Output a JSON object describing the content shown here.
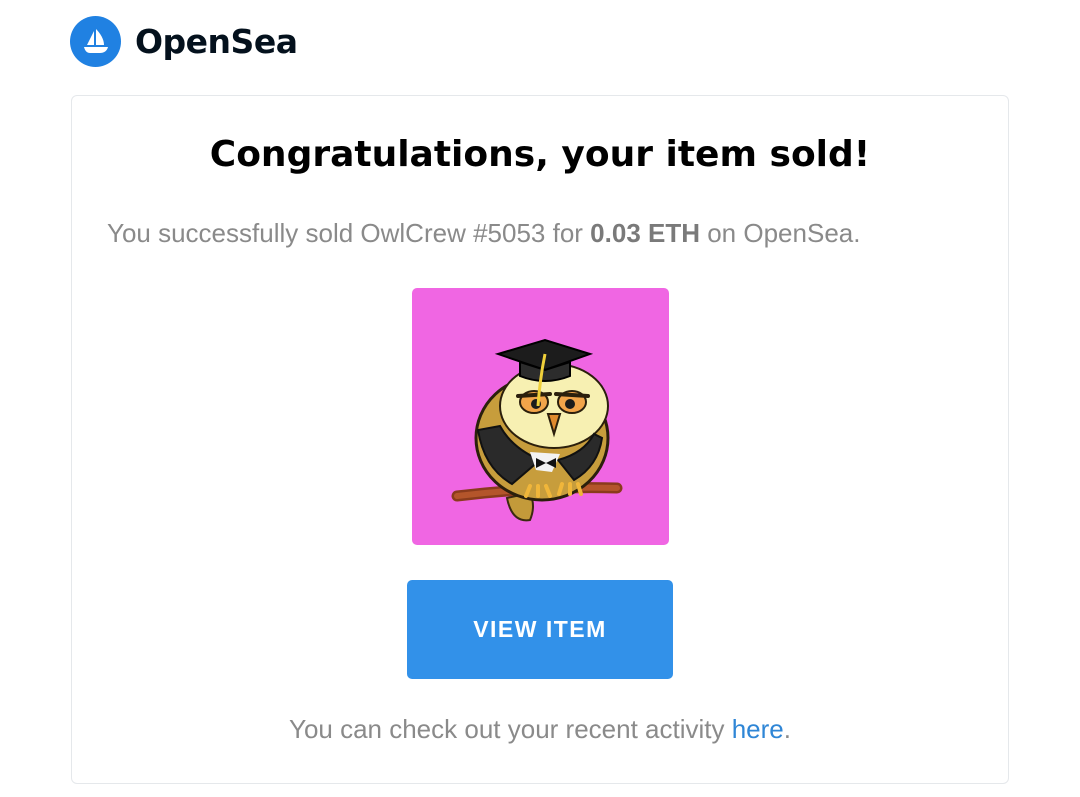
{
  "header": {
    "brand_name": "OpenSea",
    "logo_icon": "opensea-ship-icon",
    "brand_color": "#2081e2"
  },
  "main": {
    "headline": "Congratulations, your item sold!",
    "message": {
      "prefix": "You successfully sold OwlCrew #5053 for ",
      "price": "0.03 ETH",
      "suffix": " on OpenSea."
    },
    "item_image": {
      "icon": "owl-graduate-nft-image",
      "background": "#f066e3"
    },
    "view_button_label": "VIEW ITEM",
    "button_color": "#3291e9",
    "footer": {
      "prefix": "You can check out your recent activity ",
      "link_text": "here",
      "suffix": "."
    }
  }
}
